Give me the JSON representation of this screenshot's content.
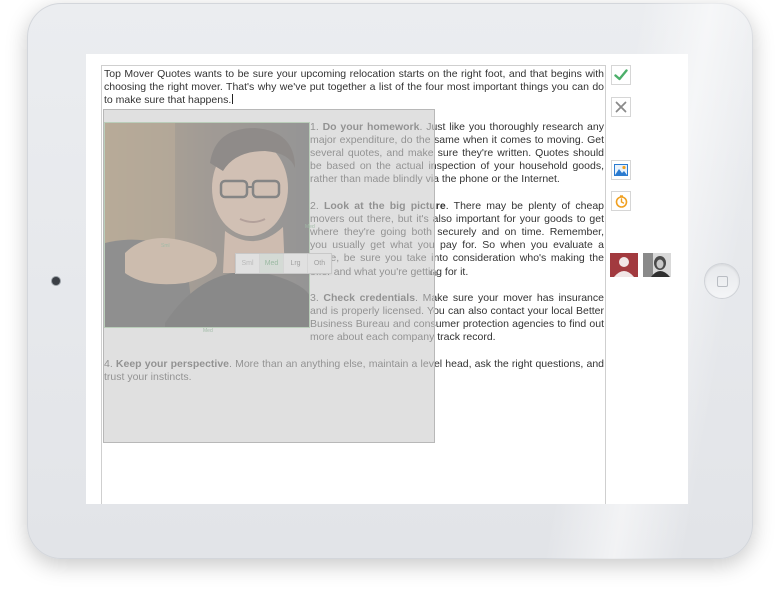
{
  "editor": {
    "intro": "Top Mover Quotes wants to be sure your upcoming relocation starts on the right foot, and that begins with choosing the right mover. That's why we've put together a list of the four most important things you can do to make sure that happens.",
    "items": [
      {
        "num": "1.",
        "heading": "Do your homework",
        "body": ". Just like you thoroughly research any major expenditure, do the same when it comes to moving. Get several quotes, and make sure they're written. Quotes should be based on the actual inspection of your household goods, rather than made blindly via the phone or the Internet."
      },
      {
        "num": "2.",
        "heading": "Look at the big picture",
        "body": ". There may be plenty of cheap movers out there, but it's also important for your goods to get where they're going both securely and on time. Remember, you usually get what you pay for. So when you evaluate a quote, be sure you take into consideration who's making the offer and what you're getting for it."
      },
      {
        "num": "3.",
        "heading": "Check credentials",
        "body": ". Make sure your mover has insurance and is properly licensed. You can also contact your local Better Business Bureau and consumer protection agencies to find out more about each company track record."
      },
      {
        "num": "4.",
        "heading": "Keep your perspective",
        "body": ". More than an anything else, maintain a level head, ask the right questions, and trust your instincts."
      }
    ],
    "image_handles": {
      "left": "Sml",
      "right": "Med",
      "bottom": "Med",
      "overlay_right": "Lrg"
    },
    "size_options": [
      "Sml",
      "Med",
      "Lrg",
      "Oth"
    ],
    "size_selected": "Med"
  },
  "tools": {
    "confirm_icon": "check-icon",
    "cancel_icon": "close-icon",
    "image_icon": "image-icon",
    "timer_icon": "timer-icon"
  },
  "colors": {
    "accent_green": "#4caf6a",
    "cancel_gray": "#8a8a8a",
    "image_blue": "#2b7bd0",
    "timer_orange": "#f0a020",
    "avatar_red": "#a23a3f"
  }
}
